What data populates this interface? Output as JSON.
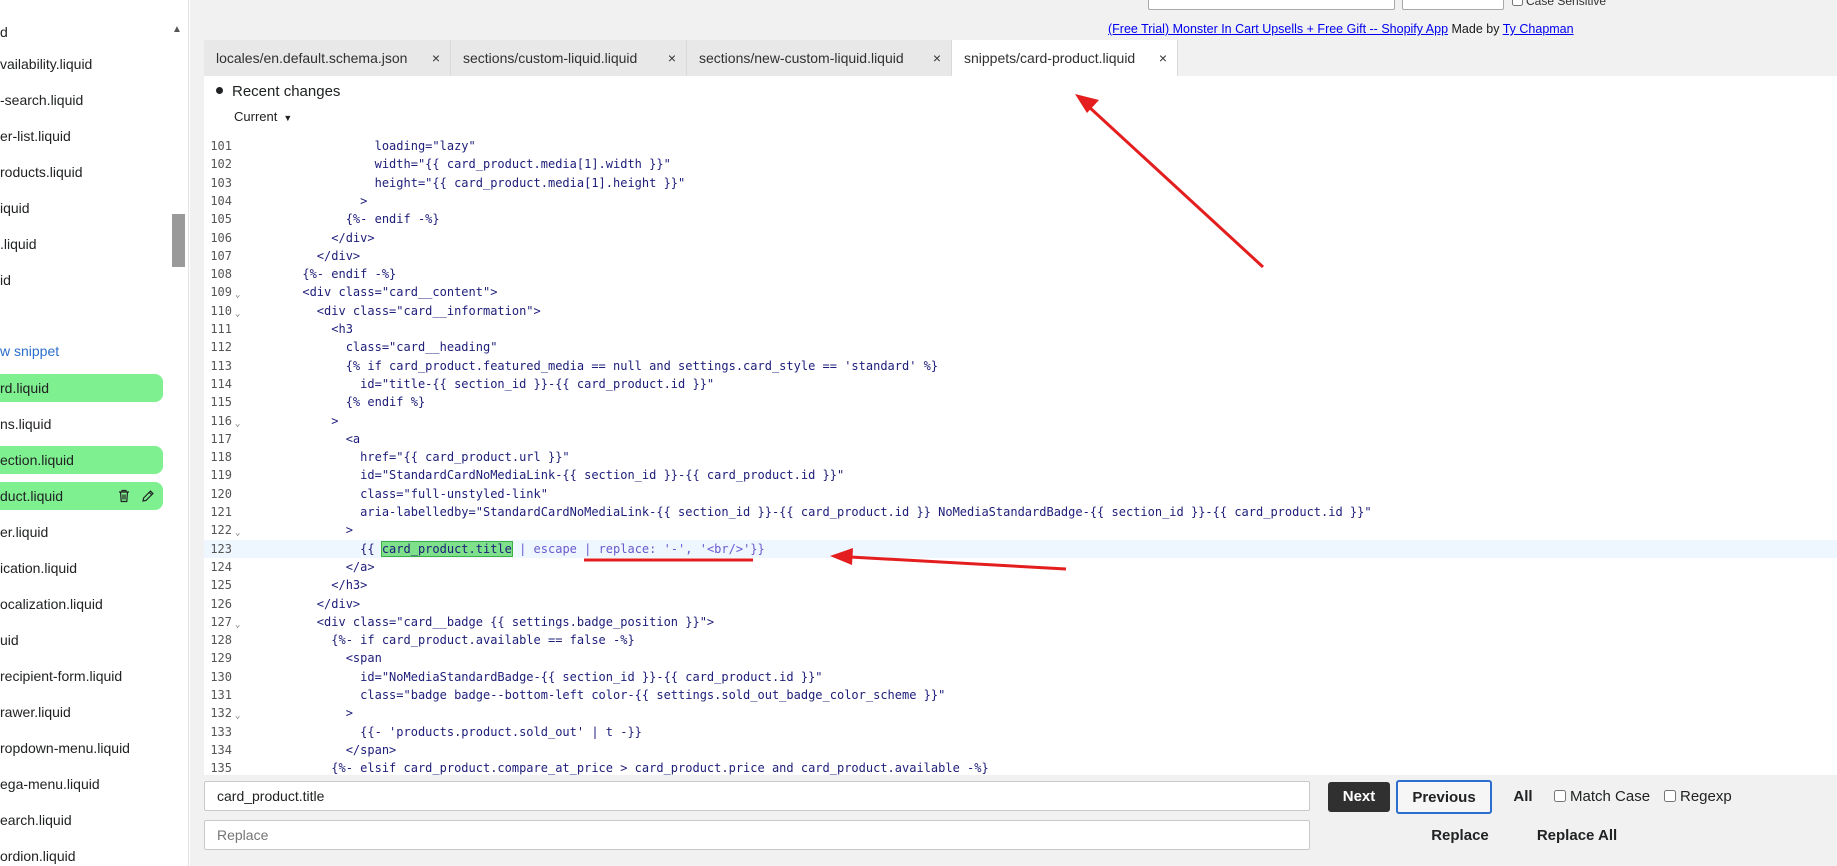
{
  "sidebar": {
    "items": [
      {
        "label": "d"
      },
      {
        "label": "vailability.liquid"
      },
      {
        "label": "-search.liquid"
      },
      {
        "label": "er-list.liquid"
      },
      {
        "label": "roducts.liquid"
      },
      {
        "label": "iquid"
      },
      {
        "label": ".liquid"
      },
      {
        "label": "id"
      },
      {
        "label": "w snippet"
      },
      {
        "label": "rd.liquid"
      },
      {
        "label": "ns.liquid"
      },
      {
        "label": "ection.liquid"
      },
      {
        "label": "duct.liquid"
      },
      {
        "label": "er.liquid"
      },
      {
        "label": "ication.liquid"
      },
      {
        "label": "ocalization.liquid"
      },
      {
        "label": "uid"
      },
      {
        "label": "recipient-form.liquid"
      },
      {
        "label": "rawer.liquid"
      },
      {
        "label": "ropdown-menu.liquid"
      },
      {
        "label": "ega-menu.liquid"
      },
      {
        "label": "earch.liquid"
      },
      {
        "label": "ordion.liquid"
      }
    ]
  },
  "header": {
    "case_sensitive": "Case Sensitive",
    "promo_link": "(Free Trial) Monster In Cart Upsells + Free Gift -- Shopify App",
    "promo_made_by": " Made by ",
    "promo_author": "Ty Chapman"
  },
  "tabs": [
    {
      "label": "locales/en.default.schema.json",
      "close": "×"
    },
    {
      "label": "sections/custom-liquid.liquid",
      "close": "×"
    },
    {
      "label": "sections/new-custom-liquid.liquid",
      "close": "×"
    },
    {
      "label_prefix": "snippets/",
      "label_main": "card-product.liquid",
      "close": "×"
    }
  ],
  "editor": {
    "recent_changes": "Recent changes",
    "version": "Current"
  },
  "code_lines": [
    {
      "n": "101",
      "t": "                loading=\"lazy\""
    },
    {
      "n": "102",
      "t": "                width=\"{{ card_product.media[1].width }}\""
    },
    {
      "n": "103",
      "t": "                height=\"{{ card_product.media[1].height }}\""
    },
    {
      "n": "104",
      "t": "              >"
    },
    {
      "n": "105",
      "t": "            {%- endif -%}"
    },
    {
      "n": "106",
      "t": "          </div>"
    },
    {
      "n": "107",
      "t": "        </div>"
    },
    {
      "n": "108",
      "t": "      {%- endif -%}"
    },
    {
      "n": "109",
      "t": "      <div class=\"card__content\">"
    },
    {
      "n": "110",
      "t": "        <div class=\"card__information\">"
    },
    {
      "n": "111",
      "t": "          <h3"
    },
    {
      "n": "112",
      "t": "            class=\"card__heading\""
    },
    {
      "n": "113",
      "t": "            {% if card_product.featured_media == null and settings.card_style == 'standard' %}"
    },
    {
      "n": "114",
      "t": "              id=\"title-{{ section_id }}-{{ card_product.id }}\""
    },
    {
      "n": "115",
      "t": "            {% endif %}"
    },
    {
      "n": "116",
      "t": "          >"
    },
    {
      "n": "117",
      "t": "            <a"
    },
    {
      "n": "118",
      "t": "              href=\"{{ card_product.url }}\""
    },
    {
      "n": "119",
      "t": "              id=\"StandardCardNoMediaLink-{{ section_id }}-{{ card_product.id }}\""
    },
    {
      "n": "120",
      "t": "              class=\"full-unstyled-link\""
    },
    {
      "n": "121",
      "t": "              aria-labelledby=\"StandardCardNoMediaLink-{{ section_id }}-{{ card_product.id }} NoMediaStandardBadge-{{ section_id }}-{{ card_product.id }}\""
    },
    {
      "n": "122",
      "t": "            >"
    },
    {
      "n": "123",
      "pre": "              {{ ",
      "hl": "card_product.title",
      "post": " | escape | replace: '-', '<br/>'}}"
    },
    {
      "n": "124",
      "t": "            </a>"
    },
    {
      "n": "125",
      "t": "          </h3>"
    },
    {
      "n": "126",
      "t": "        </div>"
    },
    {
      "n": "127",
      "t": "        <div class=\"card__badge {{ settings.badge_position }}\">"
    },
    {
      "n": "128",
      "t": "          {%- if card_product.available == false -%}"
    },
    {
      "n": "129",
      "t": "            <span"
    },
    {
      "n": "130",
      "t": "              id=\"NoMediaStandardBadge-{{ section_id }}-{{ card_product.id }}\""
    },
    {
      "n": "131",
      "t": "              class=\"badge badge--bottom-left color-{{ settings.sold_out_badge_color_scheme }}\""
    },
    {
      "n": "132",
      "t": "            >"
    },
    {
      "n": "133",
      "t": "              {{- 'products.product.sold_out' | t -}}"
    },
    {
      "n": "134",
      "t": "            </span>"
    },
    {
      "n": "135",
      "t": "          {%- elsif card_product.compare_at_price > card_product.price and card_product.available -%}"
    }
  ],
  "search": {
    "find_value": "card_product.title",
    "replace_placeholder": "Replace",
    "next": "Next",
    "previous": "Previous",
    "all": "All",
    "match_case": "Match Case",
    "regexp": "Regexp",
    "replace": "Replace",
    "replace_all": "Replace All"
  },
  "colors": {
    "highlight_green": "#7ef08f",
    "annotation_red": "#e41e1e",
    "focus_blue": "#2c6ecb"
  }
}
